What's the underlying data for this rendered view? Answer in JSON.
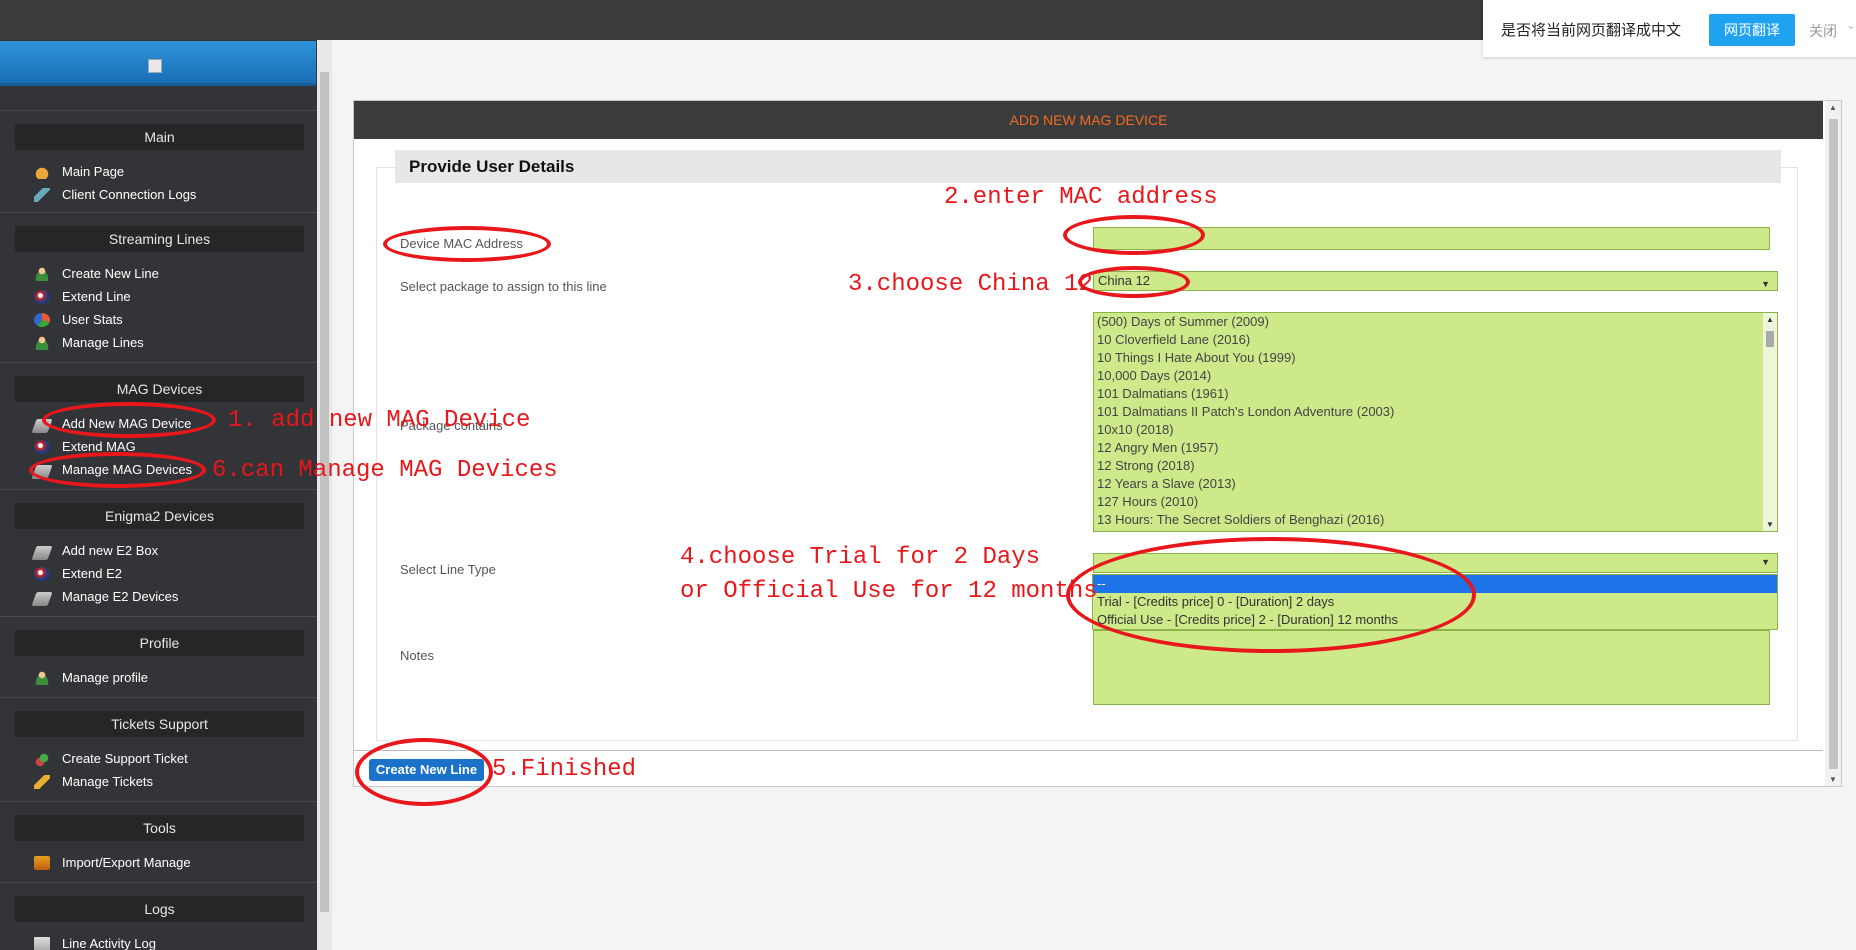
{
  "translate_bar": {
    "prompt": "是否将当前网页翻译成中文",
    "translate_button": "网页翻译",
    "close": "关闭",
    "chevron": "⌄"
  },
  "sidebar": {
    "sections": [
      {
        "title": "Main",
        "items": [
          {
            "label": "Main Page",
            "icon": "home-icon"
          },
          {
            "label": "Client Connection Logs",
            "icon": "plug-icon"
          }
        ]
      },
      {
        "title": "Streaming Lines",
        "items": [
          {
            "label": "Create New Line",
            "icon": "user-add-icon"
          },
          {
            "label": "Extend Line",
            "icon": "ball-icon"
          },
          {
            "label": "User Stats",
            "icon": "pie-chart-icon"
          },
          {
            "label": "Manage Lines",
            "icon": "users-icon"
          }
        ]
      },
      {
        "title": "MAG Devices",
        "items": [
          {
            "label": "Add New MAG Device",
            "icon": "device-add-icon"
          },
          {
            "label": "Extend MAG",
            "icon": "ball-icon"
          },
          {
            "label": "Manage MAG Devices",
            "icon": "device-icon"
          }
        ]
      },
      {
        "title": "Enigma2 Devices",
        "items": [
          {
            "label": "Add new E2 Box",
            "icon": "device-add-icon"
          },
          {
            "label": "Extend E2",
            "icon": "ball-icon"
          },
          {
            "label": "Manage E2 Devices",
            "icon": "device-icon"
          }
        ]
      },
      {
        "title": "Profile",
        "items": [
          {
            "label": "Manage profile",
            "icon": "user-icon"
          }
        ]
      },
      {
        "title": "Tickets Support",
        "items": [
          {
            "label": "Create Support Ticket",
            "icon": "ticket-add-icon"
          },
          {
            "label": "Manage Tickets",
            "icon": "ticket-icon"
          }
        ]
      },
      {
        "title": "Tools",
        "items": [
          {
            "label": "Import/Export Manage",
            "icon": "export-icon"
          }
        ]
      },
      {
        "title": "Logs",
        "items": [
          {
            "label": "Line Activity Log",
            "icon": "log-icon"
          }
        ]
      }
    ]
  },
  "panel": {
    "title": "ADD NEW MAG DEVICE",
    "section_title": "Provide User Details",
    "labels": {
      "mac": "Device MAC Address",
      "package": "Select package to assign to this line",
      "contains": "Package contains",
      "line_type": "Select Line Type",
      "notes": "Notes"
    },
    "package_value": "China 12",
    "mac_value": "",
    "package_contents": [
      "(500) Days of Summer (2009)",
      "10 Cloverfield Lane (2016)",
      "10 Things I Hate About You (1999)",
      "10,000 Days (2014)",
      "101 Dalmatians (1961)",
      "101 Dalmatians II Patch's London Adventure (2003)",
      "10x10 (2018)",
      "12 Angry Men (1957)",
      "12 Strong (2018)",
      "12 Years a Slave (2013)",
      "127 Hours (2010)",
      "13 Hours: The Secret Soldiers of Benghazi (2016)"
    ],
    "line_type_options": [
      "--",
      "Trial - [Credits price] 0 - [Duration] 2 days",
      "Official Use - [Credits price] 2 - [Duration] 12 months"
    ],
    "submit": "Create New Line"
  },
  "annotations": {
    "step1": "1. add new MAG Device",
    "step2": "2.enter MAC address",
    "step3": "3.choose China 12",
    "step4a": "4.choose Trial for 2 Days",
    "step4b": "or Official Use for 12 months",
    "step5": "5.Finished",
    "step6": "6.can Manage MAG Devices"
  },
  "colors": {
    "annotation": "#e8171b",
    "panel_title": "#f26b1d",
    "field_bg": "#cde98a",
    "button": "#1a73c9",
    "sidebar_bg": "#333437"
  }
}
